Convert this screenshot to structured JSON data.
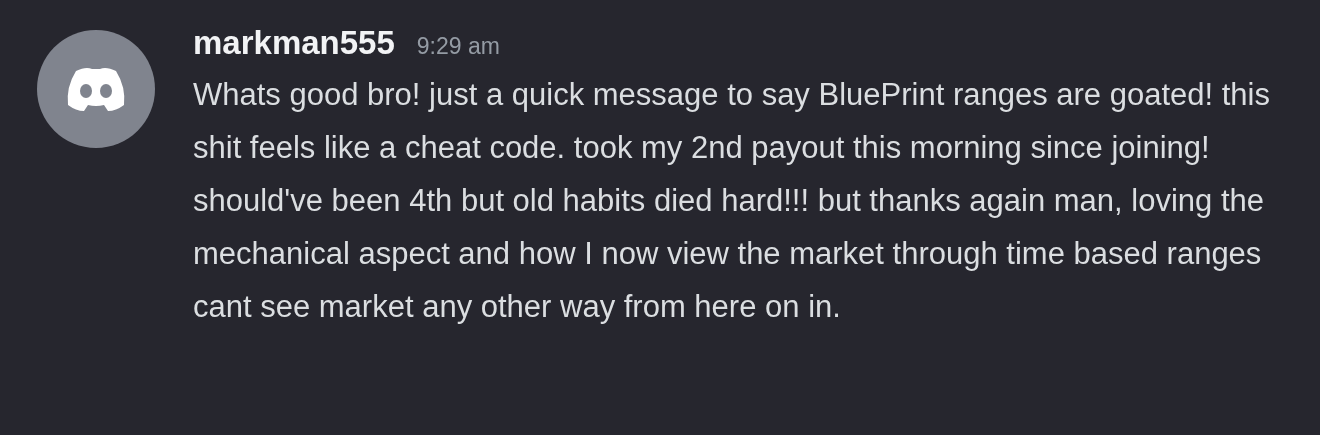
{
  "message": {
    "author": "markman555",
    "time": "9:29 am",
    "text": "Whats good bro! just a quick message to say BluePrint ranges are goated! this shit feels like a cheat code. took my 2nd payout this morning since joining! should've been 4th but old habits died hard!!! but thanks again man, loving the mechanical aspect and how I now view the market through time based ranges cant see market any other way from here on in."
  }
}
